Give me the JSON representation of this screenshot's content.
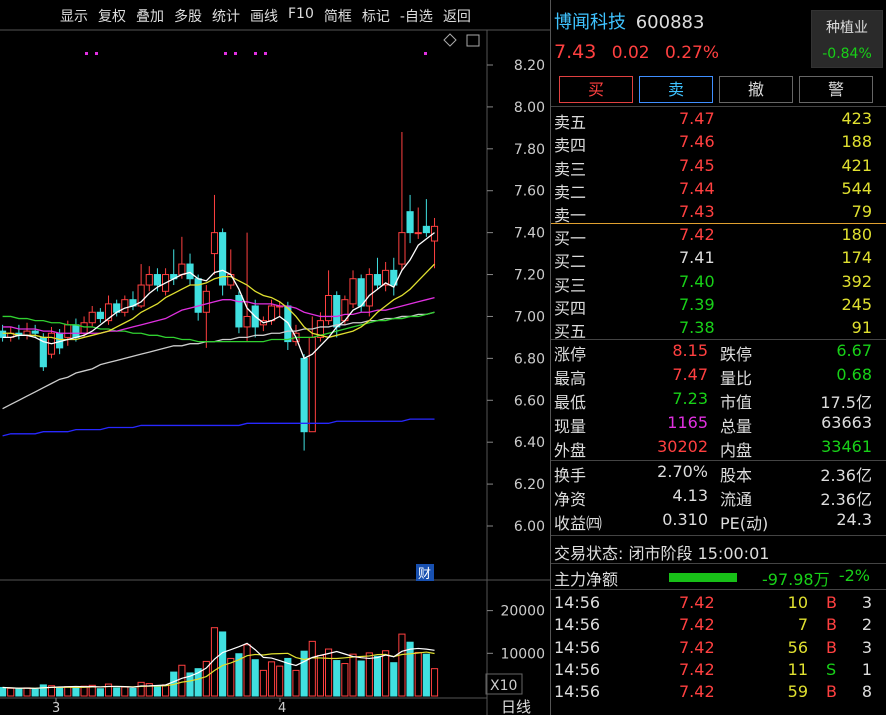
{
  "toolbar": [
    "显示",
    "复权",
    "叠加",
    "多股",
    "统计",
    "画线",
    "F10",
    "简框",
    "标记",
    "-自选",
    "返回"
  ],
  "price_axis": [
    "8.20",
    "8.00",
    "7.80",
    "7.60",
    "7.40",
    "7.20",
    "7.00",
    "6.80",
    "6.60",
    "6.40",
    "6.20",
    "6.00"
  ],
  "vol_axis": [
    "20000",
    "10000"
  ],
  "vol_unit": "X10",
  "x_labels": [
    "3",
    "4"
  ],
  "period": "日线",
  "fin_mark": "财",
  "stock": {
    "name": "博闻科技",
    "code": "600883",
    "price": "7.43",
    "change": "0.02",
    "pct": "0.27%"
  },
  "sector": {
    "name": "种植业",
    "pct": "-0.84%"
  },
  "buttons": [
    "买",
    "卖",
    "撤",
    "警"
  ],
  "asks": [
    {
      "label": "卖五",
      "price": "7.47",
      "vol": "423"
    },
    {
      "label": "卖四",
      "price": "7.46",
      "vol": "188"
    },
    {
      "label": "卖三",
      "price": "7.45",
      "vol": "421"
    },
    {
      "label": "卖二",
      "price": "7.44",
      "vol": "544"
    },
    {
      "label": "卖一",
      "price": "7.43",
      "vol": "79"
    }
  ],
  "bids": [
    {
      "label": "买一",
      "price": "7.42",
      "vol": "180",
      "color": "red"
    },
    {
      "label": "买二",
      "price": "7.41",
      "vol": "174",
      "color": "white"
    },
    {
      "label": "买三",
      "price": "7.40",
      "vol": "392",
      "color": "green"
    },
    {
      "label": "买四",
      "price": "7.39",
      "vol": "245",
      "color": "green"
    },
    {
      "label": "买五",
      "price": "7.38",
      "vol": "91",
      "color": "green"
    }
  ],
  "stats": [
    {
      "l1": "涨停",
      "v1": "8.15",
      "c1": "red",
      "l2": "跌停",
      "v2": "6.67",
      "c2": "green"
    },
    {
      "l1": "最高",
      "v1": "7.47",
      "c1": "red",
      "l2": "量比",
      "v2": "0.68",
      "c2": "green"
    },
    {
      "l1": "最低",
      "v1": "7.23",
      "c1": "green",
      "l2": "市值",
      "v2": "17.5亿",
      "c2": "white"
    },
    {
      "l1": "现量",
      "v1": "1165",
      "c1": "mag",
      "l2": "总量",
      "v2": "63663",
      "c2": "white"
    },
    {
      "l1": "外盘",
      "v1": "30202",
      "c1": "red",
      "l2": "内盘",
      "v2": "33461",
      "c2": "green"
    }
  ],
  "stats2": [
    {
      "l1": "换手",
      "v1": "2.70%",
      "l2": "股本",
      "v2": "2.36亿"
    },
    {
      "l1": "净资",
      "v1": "4.13",
      "l2": "流通",
      "v2": "2.36亿"
    },
    {
      "l1": "收益㈣",
      "v1": "0.310",
      "l2": "PE(动)",
      "v2": "24.3"
    }
  ],
  "trade_status": "交易状态: 闭市阶段 15:00:01",
  "main_flow": {
    "label": "主力净额",
    "value": "-97.98万",
    "pct": "-2%"
  },
  "ticks": [
    {
      "time": "14:56",
      "price": "7.42",
      "vol": "10",
      "side": "B",
      "n": "3"
    },
    {
      "time": "14:56",
      "price": "7.42",
      "vol": "7",
      "side": "B",
      "n": "2"
    },
    {
      "time": "14:56",
      "price": "7.42",
      "vol": "56",
      "side": "B",
      "n": "3"
    },
    {
      "time": "14:56",
      "price": "7.42",
      "vol": "11",
      "side": "S",
      "n": "1"
    },
    {
      "time": "14:56",
      "price": "7.42",
      "vol": "59",
      "side": "B",
      "n": "8"
    }
  ],
  "colors": {
    "up": "#ff4040",
    "down": "#40e0e0",
    "ma5": "#ffffff",
    "ma10": "#e0e030",
    "ma20": "#e030e0",
    "ma60": "#30d030",
    "ma120": "#cccccc",
    "ma250": "#2828ff"
  },
  "candles": [
    {
      "o": 6.93,
      "c": 6.9,
      "h": 6.96,
      "l": 6.88,
      "v": 2000
    },
    {
      "o": 6.9,
      "c": 6.92,
      "h": 6.95,
      "l": 6.88,
      "v": 1800
    },
    {
      "o": 6.92,
      "c": 6.91,
      "h": 6.96,
      "l": 6.89,
      "v": 1700
    },
    {
      "o": 6.91,
      "c": 6.93,
      "h": 6.97,
      "l": 6.89,
      "v": 1900
    },
    {
      "o": 6.93,
      "c": 6.92,
      "h": 6.96,
      "l": 6.9,
      "v": 1600
    },
    {
      "o": 6.9,
      "c": 6.76,
      "h": 6.92,
      "l": 6.74,
      "v": 2600
    },
    {
      "o": 6.82,
      "c": 6.92,
      "h": 6.95,
      "l": 6.8,
      "v": 2400
    },
    {
      "o": 6.92,
      "c": 6.85,
      "h": 6.94,
      "l": 6.82,
      "v": 2100
    },
    {
      "o": 6.9,
      "c": 6.96,
      "h": 6.98,
      "l": 6.86,
      "v": 2200
    },
    {
      "o": 6.96,
      "c": 6.9,
      "h": 6.99,
      "l": 6.88,
      "v": 1900
    },
    {
      "o": 6.92,
      "c": 6.97,
      "h": 7.0,
      "l": 6.9,
      "v": 2300
    },
    {
      "o": 6.97,
      "c": 7.02,
      "h": 7.05,
      "l": 6.95,
      "v": 2500
    },
    {
      "o": 7.02,
      "c": 6.99,
      "h": 7.04,
      "l": 6.97,
      "v": 1700
    },
    {
      "o": 6.98,
      "c": 7.06,
      "h": 7.1,
      "l": 6.96,
      "v": 2800
    },
    {
      "o": 7.06,
      "c": 7.02,
      "h": 7.08,
      "l": 7.0,
      "v": 1900
    },
    {
      "o": 7.02,
      "c": 7.08,
      "h": 7.1,
      "l": 7.0,
      "v": 2100
    },
    {
      "o": 7.08,
      "c": 7.05,
      "h": 7.12,
      "l": 7.03,
      "v": 1800
    },
    {
      "o": 7.05,
      "c": 7.15,
      "h": 7.25,
      "l": 7.04,
      "v": 3200
    },
    {
      "o": 7.15,
      "c": 7.2,
      "h": 7.24,
      "l": 7.12,
      "v": 2900
    },
    {
      "o": 7.2,
      "c": 7.15,
      "h": 7.23,
      "l": 7.12,
      "v": 2400
    },
    {
      "o": 7.12,
      "c": 7.2,
      "h": 7.23,
      "l": 7.1,
      "v": 2600
    },
    {
      "o": 7.2,
      "c": 7.18,
      "h": 7.32,
      "l": 7.15,
      "v": 5600
    },
    {
      "o": 7.2,
      "c": 7.25,
      "h": 7.38,
      "l": 7.18,
      "v": 7200
    },
    {
      "o": 7.25,
      "c": 7.18,
      "h": 7.3,
      "l": 7.15,
      "v": 5400
    },
    {
      "o": 7.18,
      "c": 7.02,
      "h": 7.2,
      "l": 6.98,
      "v": 6400
    },
    {
      "o": 7.02,
      "c": 7.12,
      "h": 7.15,
      "l": 6.85,
      "v": 8100
    },
    {
      "o": 7.3,
      "c": 7.4,
      "h": 7.58,
      "l": 7.2,
      "v": 16000
    },
    {
      "o": 7.4,
      "c": 7.15,
      "h": 7.42,
      "l": 7.1,
      "v": 15000
    },
    {
      "o": 7.15,
      "c": 7.2,
      "h": 7.32,
      "l": 7.13,
      "v": 8800
    },
    {
      "o": 7.1,
      "c": 6.95,
      "h": 7.12,
      "l": 6.92,
      "v": 9900
    },
    {
      "o": 6.95,
      "c": 7.0,
      "h": 7.4,
      "l": 6.88,
      "v": 12000
    },
    {
      "o": 7.05,
      "c": 6.95,
      "h": 7.08,
      "l": 6.9,
      "v": 8500
    },
    {
      "o": 6.96,
      "c": 6.98,
      "h": 7.0,
      "l": 6.93,
      "v": 6000
    },
    {
      "o": 6.98,
      "c": 7.05,
      "h": 7.08,
      "l": 6.96,
      "v": 8000
    },
    {
      "o": 7.05,
      "c": 7.05,
      "h": 7.07,
      "l": 7.0,
      "v": 7000
    },
    {
      "o": 7.05,
      "c": 6.88,
      "h": 7.07,
      "l": 6.84,
      "v": 8800
    },
    {
      "o": 6.88,
      "c": 6.92,
      "h": 6.96,
      "l": 6.86,
      "v": 6000
    },
    {
      "o": 6.8,
      "c": 6.45,
      "h": 6.82,
      "l": 6.36,
      "v": 10500
    },
    {
      "o": 6.45,
      "c": 6.9,
      "h": 7.0,
      "l": 6.45,
      "v": 12800
    },
    {
      "o": 6.9,
      "c": 6.98,
      "h": 7.02,
      "l": 6.88,
      "v": 9500
    },
    {
      "o": 6.98,
      "c": 7.1,
      "h": 7.22,
      "l": 6.96,
      "v": 11000
    },
    {
      "o": 7.1,
      "c": 6.95,
      "h": 7.12,
      "l": 6.9,
      "v": 8300
    },
    {
      "o": 6.98,
      "c": 7.08,
      "h": 7.1,
      "l": 6.96,
      "v": 7600
    },
    {
      "o": 7.06,
      "c": 7.18,
      "h": 7.22,
      "l": 7.04,
      "v": 9800
    },
    {
      "o": 7.18,
      "c": 7.05,
      "h": 7.2,
      "l": 7.02,
      "v": 8200
    },
    {
      "o": 7.05,
      "c": 7.2,
      "h": 7.23,
      "l": 7.0,
      "v": 10100
    },
    {
      "o": 7.2,
      "c": 7.15,
      "h": 7.28,
      "l": 7.13,
      "v": 9300
    },
    {
      "o": 7.15,
      "c": 7.22,
      "h": 7.26,
      "l": 7.12,
      "v": 10600
    },
    {
      "o": 7.22,
      "c": 7.15,
      "h": 7.28,
      "l": 7.1,
      "v": 7800
    },
    {
      "o": 7.25,
      "c": 7.4,
      "h": 7.88,
      "l": 7.22,
      "v": 14500
    },
    {
      "o": 7.5,
      "c": 7.4,
      "h": 7.58,
      "l": 7.35,
      "v": 12600
    },
    {
      "o": 7.4,
      "c": 7.4,
      "h": 7.52,
      "l": 7.37,
      "v": 10200
    },
    {
      "o": 7.43,
      "c": 7.4,
      "h": 7.56,
      "l": 7.38,
      "v": 9800
    },
    {
      "o": 7.36,
      "c": 7.43,
      "h": 7.47,
      "l": 7.23,
      "v": 6400
    }
  ],
  "ma_lines": {
    "ma5": [
      6.9,
      6.9,
      6.91,
      6.91,
      6.9,
      6.88,
      6.87,
      6.88,
      6.89,
      6.9,
      6.91,
      6.93,
      6.96,
      6.99,
      7.02,
      7.04,
      7.05,
      7.07,
      7.11,
      7.14,
      7.16,
      7.18,
      7.2,
      7.21,
      7.18,
      7.17,
      7.21,
      7.22,
      7.2,
      7.13,
      7.04,
      7.0,
      6.97,
      6.98,
      7.0,
      6.97,
      6.9,
      6.8,
      6.82,
      6.86,
      6.9,
      6.95,
      6.98,
      7.03,
      7.05,
      7.1,
      7.13,
      7.16,
      7.14,
      7.22,
      7.27,
      7.34,
      7.37,
      7.4
    ],
    "ma10": [
      6.92,
      6.92,
      6.91,
      6.91,
      6.91,
      6.9,
      6.9,
      6.89,
      6.89,
      6.89,
      6.9,
      6.91,
      6.92,
      6.93,
      6.95,
      6.97,
      6.99,
      7.02,
      7.04,
      7.06,
      7.09,
      7.11,
      7.13,
      7.15,
      7.15,
      7.16,
      7.18,
      7.19,
      7.19,
      7.17,
      7.15,
      7.12,
      7.1,
      7.09,
      7.07,
      7.04,
      7.0,
      6.95,
      6.92,
      6.91,
      6.9,
      6.91,
      6.92,
      6.93,
      6.95,
      6.98,
      7.02,
      7.05,
      7.08,
      7.1,
      7.13,
      7.17,
      7.21,
      7.25
    ],
    "ma20": [
      6.95,
      6.95,
      6.94,
      6.94,
      6.94,
      6.93,
      6.93,
      6.92,
      6.92,
      6.92,
      6.92,
      6.92,
      6.92,
      6.93,
      6.93,
      6.94,
      6.95,
      6.96,
      6.97,
      6.98,
      6.99,
      7.01,
      7.03,
      7.04,
      7.05,
      7.06,
      7.07,
      7.08,
      7.08,
      7.07,
      7.07,
      7.06,
      7.06,
      7.06,
      7.05,
      7.05,
      7.04,
      7.02,
      7.01,
      7.0,
      7.0,
      7.0,
      7.01,
      7.01,
      7.02,
      7.02,
      7.03,
      7.03,
      7.04,
      7.05,
      7.06,
      7.07,
      7.08,
      7.09
    ],
    "ma60": [
      7.0,
      7.0,
      6.99,
      6.99,
      6.98,
      6.98,
      6.97,
      6.97,
      6.96,
      6.96,
      6.95,
      6.95,
      6.94,
      6.94,
      6.93,
      6.93,
      6.92,
      6.92,
      6.91,
      6.91,
      6.9,
      6.9,
      6.89,
      6.89,
      6.88,
      6.88,
      6.88,
      6.88,
      6.88,
      6.88,
      6.88,
      6.88,
      6.88,
      6.89,
      6.89,
      6.89,
      6.9,
      6.9,
      6.9,
      6.91,
      6.92,
      6.93,
      6.94,
      6.95,
      6.96,
      6.97,
      6.98,
      6.98,
      6.99,
      6.99,
      7.0,
      7.0,
      7.01,
      7.02
    ],
    "ma120": [
      6.56,
      6.58,
      6.6,
      6.62,
      6.64,
      6.66,
      6.68,
      6.7,
      6.71,
      6.73,
      6.74,
      6.75,
      6.77,
      6.78,
      6.79,
      6.8,
      6.81,
      6.82,
      6.83,
      6.84,
      6.85,
      6.86,
      6.86,
      6.87,
      6.87,
      6.88,
      6.88,
      6.89,
      6.89,
      6.9,
      6.9,
      6.91,
      6.91,
      6.92,
      6.92,
      6.93,
      6.93,
      6.94,
      6.94,
      6.95,
      6.95,
      6.96,
      6.96,
      6.97,
      6.97,
      6.98,
      6.98,
      6.99,
      6.99,
      7.0,
      7.0,
      7.01,
      7.01,
      7.02
    ],
    "ma250": [
      6.43,
      6.44,
      6.44,
      6.44,
      6.44,
      6.45,
      6.45,
      6.45,
      6.45,
      6.46,
      6.46,
      6.46,
      6.46,
      6.47,
      6.47,
      6.47,
      6.47,
      6.48,
      6.48,
      6.48,
      6.48,
      6.48,
      6.48,
      6.48,
      6.48,
      6.48,
      6.48,
      6.48,
      6.48,
      6.48,
      6.49,
      6.49,
      6.49,
      6.49,
      6.49,
      6.49,
      6.49,
      6.49,
      6.49,
      6.49,
      6.49,
      6.5,
      6.5,
      6.5,
      6.5,
      6.5,
      6.5,
      6.5,
      6.5,
      6.5,
      6.51,
      6.51,
      6.51,
      6.51
    ]
  }
}
